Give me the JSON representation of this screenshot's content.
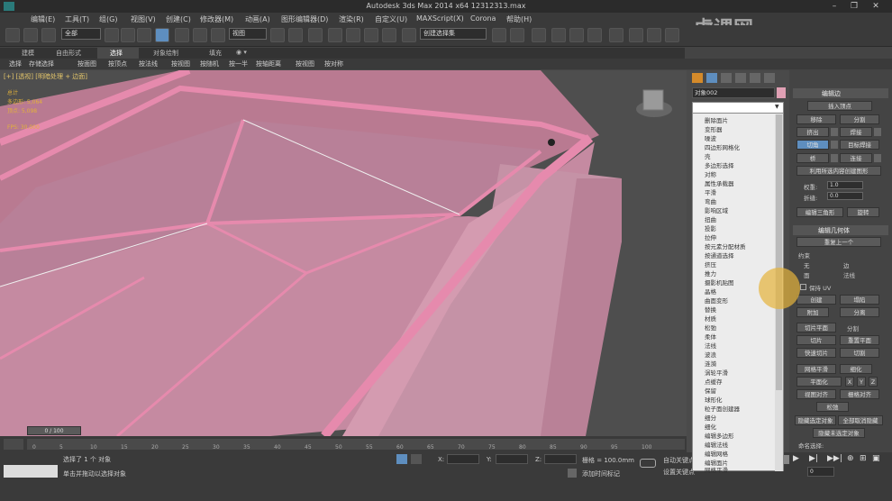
{
  "window": {
    "title": "Autodesk 3ds Max  2014 x64      12312313.max",
    "min": "–",
    "max": "❐",
    "close": "✕"
  },
  "menu": [
    "编辑(E)",
    "工具(T)",
    "组(G)",
    "视图(V)",
    "创建(C)",
    "修改器(M)",
    "动画(A)",
    "图形编辑器(D)",
    "渲染(R)",
    "自定义(U)",
    "MAXScript(X)",
    "Corona",
    "帮助(H)"
  ],
  "toolbar": {
    "filter_select": "全部",
    "ref_coord": "视图",
    "selection_set": "创建选择集"
  },
  "ribbon_tabs": [
    "建模",
    "自由形式",
    "选择",
    "对象绘制",
    "填充",
    "◉ ▾"
  ],
  "ribbon_items": [
    "选择",
    "存储选择",
    "按面图",
    "按顶点",
    "按法线",
    "按视图",
    "按随机",
    "按一半",
    "按轴距离",
    "按视图",
    "按对称"
  ],
  "viewport": {
    "label": "[+] [透视] [明暗处理 + 边面]",
    "stats": [
      "总计",
      "多边形: 5,064",
      "顶点: 5,098",
      "FPS: 30.000"
    ]
  },
  "timeline": {
    "frame": "0 / 100",
    "ticks": [
      "0",
      "5",
      "10",
      "15",
      "20",
      "25",
      "30",
      "35",
      "40",
      "45",
      "50",
      "55",
      "60",
      "65",
      "70",
      "75",
      "80",
      "85",
      "90",
      "95",
      "100"
    ]
  },
  "status": {
    "selected": "选择了 1 个 对象",
    "prompt": "单击并拖动以选择对象",
    "x_label": "X:",
    "y_label": "Y:",
    "z_label": "Z:",
    "grid": "栅格 = 100.0mm",
    "auto_key": "自动关键点",
    "set_key": "设置关键点",
    "add_time_tag": "添加时间标记",
    "frame_value": "0",
    "auto_key_mode": "选定对象"
  },
  "command_panel": {
    "object_name": "对象002",
    "modifier_list": [
      "删除面片",
      "变形器",
      "噪波",
      "四边形网格化",
      "壳",
      "多边形选择",
      "对称",
      "属性承载器",
      "平滑",
      "弯曲",
      "影响区域",
      "扭曲",
      "投影",
      "拉伸",
      "按元素分配材质",
      "按通道选择",
      "挤压",
      "推力",
      "摄影机贴图",
      "晶格",
      "曲面变形",
      "替换",
      "材质",
      "松弛",
      "柔体",
      "法线",
      "波浪",
      "涟漪",
      "涡轮平滑",
      "点缓存",
      "保留",
      "球形化",
      "粒子面创建器",
      "细分",
      "细化",
      "编辑多边形",
      "编辑法线",
      "编辑网格",
      "编辑面片",
      "网格平滑"
    ]
  },
  "edit_edges": {
    "title": "编辑边",
    "insert_vertex": "插入顶点",
    "remove": "移除",
    "split": "分割",
    "extrude": "挤出",
    "weld": "焊接",
    "chamfer": "切角",
    "target_weld": "目标焊接",
    "bridge": "桥",
    "connect": "连接",
    "create_shape": "利用所选内容创建图形",
    "weight_label": "权重:",
    "weight": "1.0",
    "crease_label": "折缝:",
    "crease": "0.0",
    "edit_tri": "编辑三角形",
    "turn": "旋转"
  },
  "edit_geometry": {
    "title": "编辑几何体",
    "repeat_last": "重复上一个",
    "constraints": "约束",
    "none": "无",
    "edge": "边",
    "face": "面",
    "normal": "法线",
    "preserve_uv": "保持 UV",
    "create": "创建",
    "collapse": "塌陷",
    "attach": "附加",
    "detach": "分离",
    "slice_plane": "切片平面",
    "split": "分割",
    "slice": "切片",
    "reset_plane": "重置平面",
    "quickslice": "快速切片",
    "cut": "切割",
    "meshsmooth": "网格平滑",
    "tessellate": "细化",
    "make_planar": "平面化",
    "x": "X",
    "y": "Y",
    "z": "Z",
    "view_align": "视图对齐",
    "grid_align": "栅格对齐",
    "relax": "松弛",
    "hide_selected": "隐藏选定对象",
    "unhide_all": "全部取消隐藏",
    "hide_unselected": "隐藏未选定对象",
    "named_sel": "命名选择:"
  },
  "watermark": "虎课网",
  "colors": {
    "accent": "#5e8ebf",
    "mesh": "#c98aa0",
    "mesh_edge": "#e07aa0"
  }
}
